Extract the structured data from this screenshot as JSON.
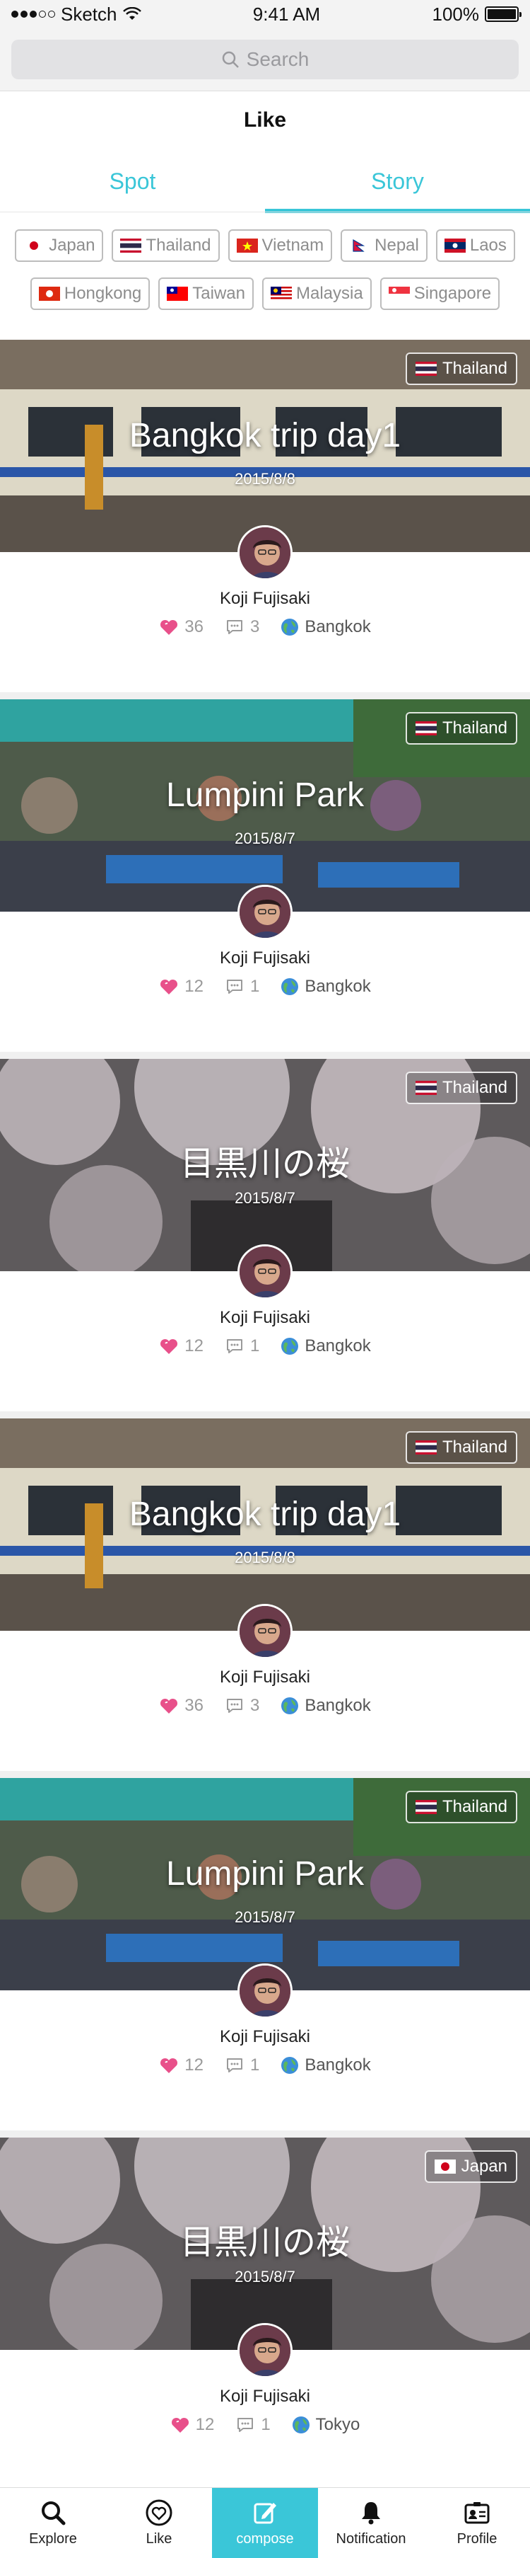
{
  "status_bar": {
    "carrier": "Sketch",
    "time": "9:41 AM",
    "battery": "100%",
    "battery_level": 1.0
  },
  "search": {
    "placeholder": "Search"
  },
  "page": {
    "title": "Like"
  },
  "tabs": [
    {
      "label": "Spot",
      "active": false
    },
    {
      "label": "Story",
      "active": true
    }
  ],
  "filters": {
    "row1": [
      "Japan",
      "Thailand",
      "Vietnam",
      "Nepal",
      "Laos"
    ],
    "row2": [
      "Hongkong",
      "Taiwan",
      "Malaysia",
      "Singapore"
    ]
  },
  "stories": [
    {
      "title": "Bangkok trip day1",
      "date": "2015/8/8",
      "country": "Thailand",
      "author": "Koji Fujisaki",
      "likes": "36",
      "comments": "3",
      "location": "Bangkok",
      "scene": "train"
    },
    {
      "title": "Lumpini Park",
      "date": "2015/8/7",
      "country": "Thailand",
      "author": "Koji Fujisaki",
      "likes": "12",
      "comments": "1",
      "location": "Bangkok",
      "scene": "park"
    },
    {
      "title": "目黒川の桜",
      "date": "2015/8/7",
      "country": "Thailand",
      "author": "Koji Fujisaki",
      "likes": "12",
      "comments": "1",
      "location": "Bangkok",
      "scene": "sakura"
    },
    {
      "title": "Bangkok trip day1",
      "date": "2015/8/8",
      "country": "Thailand",
      "author": "Koji Fujisaki",
      "likes": "36",
      "comments": "3",
      "location": "Bangkok",
      "scene": "train"
    },
    {
      "title": "Lumpini Park",
      "date": "2015/8/7",
      "country": "Thailand",
      "author": "Koji Fujisaki",
      "likes": "12",
      "comments": "1",
      "location": "Bangkok",
      "scene": "park"
    },
    {
      "title": "目黒川の桜",
      "date": "2015/8/7",
      "country": "Japan",
      "author": "Koji Fujisaki",
      "likes": "12",
      "comments": "1",
      "location": "Tokyo",
      "scene": "sakura"
    }
  ],
  "tabbar": [
    {
      "label": "Explore",
      "icon": "search-icon"
    },
    {
      "label": "Like",
      "icon": "heart-icon"
    },
    {
      "label": "compose",
      "icon": "compose-icon"
    },
    {
      "label": "Notification",
      "icon": "bell-icon"
    },
    {
      "label": "Profile",
      "icon": "profile-icon"
    }
  ],
  "colors": {
    "accent": "#3ac6d8",
    "heart": "#e8508a"
  }
}
